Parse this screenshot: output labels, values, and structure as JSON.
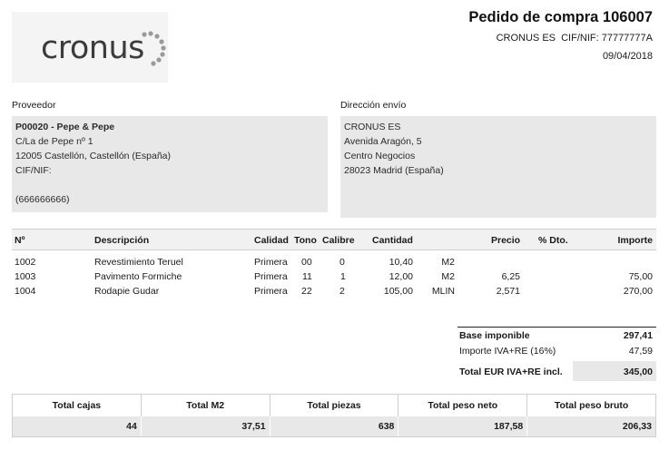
{
  "header": {
    "logo_text": "cronus",
    "title": "Pedido de compra 106007",
    "company_line": "CRONUS ES  CIF/NIF: 77777777A",
    "date": "09/04/2018"
  },
  "vendor": {
    "label": "Proveedor",
    "name": "P00020 - Pepe & Pepe",
    "address": "C/La de Pepe nº 1",
    "city": "12005 Castellón, Castellón (España)",
    "vat_label": "CIF/NIF:",
    "phone": "(666666666)"
  },
  "ship_to": {
    "label": "Dirección envío",
    "name": "CRONUS ES",
    "address": "Avenida Aragón, 5",
    "address2": "Centro Negocios",
    "city": "28023 Madrid (España)"
  },
  "lines": {
    "headers": {
      "no": "Nº",
      "description": "Descripción",
      "quality": "Calidad",
      "tone": "Tono",
      "caliber": "Calibre",
      "quantity": "Cantidad",
      "price": "Precio",
      "discount": "% Dto.",
      "amount": "Importe"
    },
    "rows": [
      {
        "no": "1002",
        "description": "Revestimiento Teruel",
        "quality": "Primera",
        "tone": "00",
        "caliber": "0",
        "quantity": "10,40",
        "unit": "M2",
        "price": "",
        "discount": "",
        "amount": ""
      },
      {
        "no": "1003",
        "description": "Pavimento Formiche",
        "quality": "Primera",
        "tone": "11",
        "caliber": "1",
        "quantity": "12,00",
        "unit": "M2",
        "price": "6,25",
        "discount": "",
        "amount": "75,00"
      },
      {
        "no": "1004",
        "description": "Rodapie Gudar",
        "quality": "Primera",
        "tone": "22",
        "caliber": "2",
        "quantity": "105,00",
        "unit": "MLIN",
        "price": "2,571",
        "discount": "",
        "amount": "270,00"
      }
    ]
  },
  "totals": {
    "base_label": "Base imponible",
    "base_value": "297,41",
    "vat_label": "Importe IVA+RE (16%)",
    "vat_value": "47,59",
    "total_label": "Total EUR IVA+RE incl.",
    "total_value": "345,00"
  },
  "summary": {
    "headers": [
      "Total cajas",
      "Total M2",
      "Total piezas",
      "Total peso neto",
      "Total peso bruto"
    ],
    "values": [
      "44",
      "37,51",
      "638",
      "187,58",
      "206,33"
    ]
  }
}
